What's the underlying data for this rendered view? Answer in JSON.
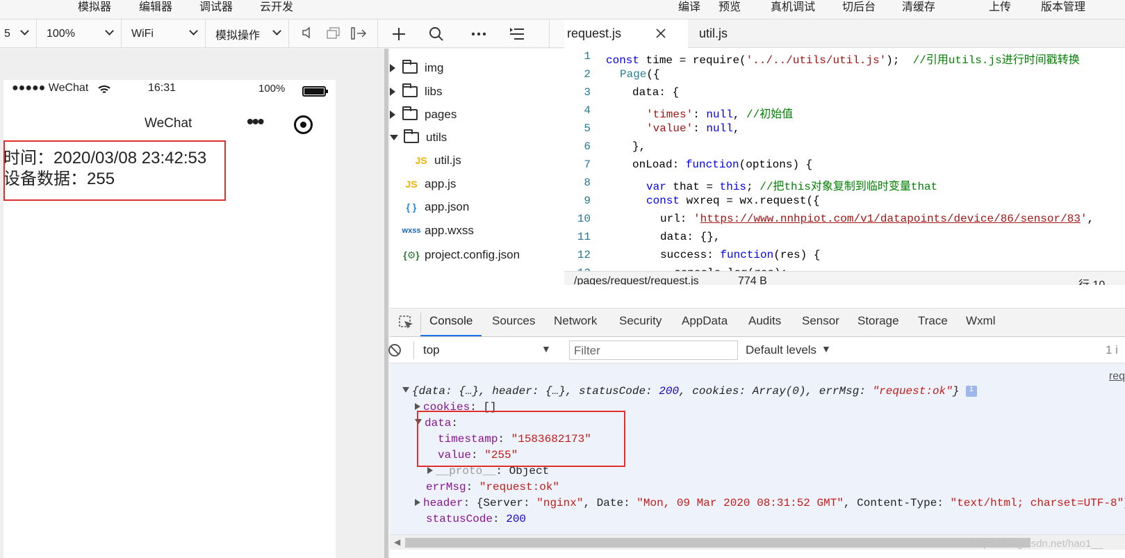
{
  "menubar": {
    "items": [
      "模拟器",
      "编辑器",
      "调试器",
      "云开发"
    ],
    "right_items": [
      "编译",
      "预览",
      "真机调试",
      "切后台",
      "清缓存",
      "上传",
      "版本管理"
    ]
  },
  "sim_toolbar": {
    "device_fragment": "5",
    "zoom": "100%",
    "network": "WiFi",
    "simulate": "模拟操作"
  },
  "phone": {
    "carrier": "●●●●● WeChat",
    "time": "16:31",
    "battery_percent": "100%",
    "nav_title": "WeChat",
    "time_line": "时间：2020/03/08 23:42:53",
    "data_line": "设备数据：255"
  },
  "filetree": {
    "items": [
      {
        "label": "img",
        "type": "folder",
        "state": "collapsed"
      },
      {
        "label": "libs",
        "type": "folder",
        "state": "collapsed"
      },
      {
        "label": "pages",
        "type": "folder",
        "state": "collapsed"
      },
      {
        "label": "utils",
        "type": "folder",
        "state": "expanded"
      },
      {
        "label": "util.js",
        "type": "js",
        "icon_text": "JS"
      },
      {
        "label": "app.js",
        "type": "js",
        "icon_text": "JS"
      },
      {
        "label": "app.json",
        "type": "json",
        "icon_text": "{ }"
      },
      {
        "label": "app.wxss",
        "type": "wxss",
        "icon_text": "wxss"
      },
      {
        "label": "project.config.json",
        "type": "config",
        "icon_text": "{⚙}"
      }
    ]
  },
  "editor": {
    "tabs": [
      {
        "label": "request.js",
        "active": true
      },
      {
        "label": "util.js",
        "active": false
      }
    ],
    "line_numbers": [
      "1",
      "2",
      "3",
      "4",
      "5",
      "6",
      "7",
      "8",
      "9",
      "10",
      "11",
      "12",
      "13"
    ],
    "status": {
      "path": "/pages/request/request.js",
      "size": "774 B",
      "position": "行 10,"
    }
  },
  "devtools": {
    "tabs": [
      "Console",
      "Sources",
      "Network",
      "Security",
      "AppData",
      "Audits",
      "Sensor",
      "Storage",
      "Trace",
      "Wxml"
    ],
    "active_tab": "Console",
    "context": "top",
    "filter_placeholder": "Filter",
    "levels": "Default levels",
    "right_count": "1 i",
    "source_link": "req"
  },
  "watermark": "https://blog.csdn.net/hao1__"
}
